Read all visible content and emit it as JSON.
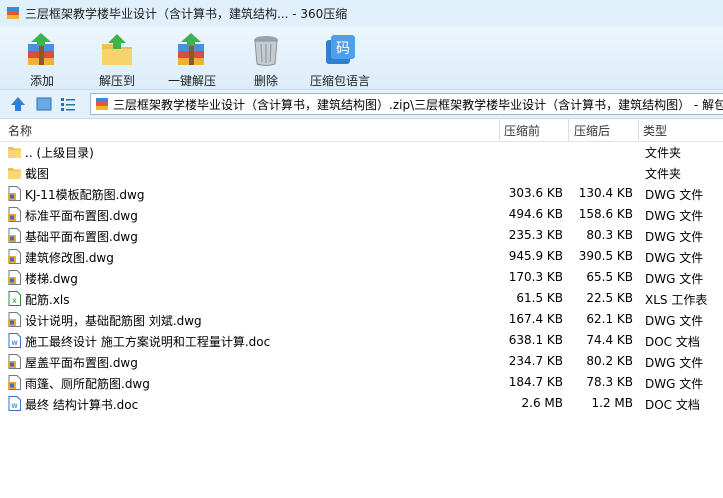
{
  "window": {
    "title": "三层框架教学楼毕业设计（含计算书，建筑结构... - 360压缩"
  },
  "toolbar": {
    "add_label": "添加",
    "extract_to_label": "解压到",
    "one_click_extract_label": "一键解压",
    "delete_label": "删除",
    "archive_language_label": "压缩包语言",
    "lang_icon_glyph": "码"
  },
  "address": {
    "path": "三层框架教学楼毕业设计（含计算书，建筑结构图）.zip\\三层框架教学楼毕业设计（含计算书，建筑结构图） - 解包"
  },
  "columns": {
    "name": "名称",
    "compressed_before": "压缩前",
    "compressed_after": "压缩后",
    "type": "类型"
  },
  "files": [
    {
      "name": ".. (上级目录)",
      "size": "",
      "packed": "",
      "type": "文件夹",
      "icon": "folder-icon"
    },
    {
      "name": "截图",
      "size": "",
      "packed": "",
      "type": "文件夹",
      "icon": "folder-icon"
    },
    {
      "name": "KJ-11模板配筋图.dwg",
      "size": "303.6 KB",
      "packed": "130.4 KB",
      "type": "DWG 文件",
      "icon": "dwg-file-icon"
    },
    {
      "name": "标准平面布置图.dwg",
      "size": "494.6 KB",
      "packed": "158.6 KB",
      "type": "DWG 文件",
      "icon": "dwg-file-icon"
    },
    {
      "name": "基础平面布置图.dwg",
      "size": "235.3 KB",
      "packed": "80.3 KB",
      "type": "DWG 文件",
      "icon": "dwg-file-icon"
    },
    {
      "name": "建筑修改图.dwg",
      "size": "945.9 KB",
      "packed": "390.5 KB",
      "type": "DWG 文件",
      "icon": "dwg-file-icon"
    },
    {
      "name": "楼梯.dwg",
      "size": "170.3 KB",
      "packed": "65.5 KB",
      "type": "DWG 文件",
      "icon": "dwg-file-icon"
    },
    {
      "name": "配筋.xls",
      "size": "61.5 KB",
      "packed": "22.5 KB",
      "type": "XLS 工作表",
      "icon": "xls-file-icon"
    },
    {
      "name": "设计说明，基础配筋图  刘斌.dwg",
      "size": "167.4 KB",
      "packed": "62.1 KB",
      "type": "DWG 文件",
      "icon": "dwg-file-icon"
    },
    {
      "name": "施工最终设计 施工方案说明和工程量计算.doc",
      "size": "638.1 KB",
      "packed": "74.4 KB",
      "type": "DOC 文档",
      "icon": "doc-file-icon"
    },
    {
      "name": "屋盖平面布置图.dwg",
      "size": "234.7 KB",
      "packed": "80.2 KB",
      "type": "DWG 文件",
      "icon": "dwg-file-icon"
    },
    {
      "name": "雨篷、厕所配筋图.dwg",
      "size": "184.7 KB",
      "packed": "78.3 KB",
      "type": "DWG 文件",
      "icon": "dwg-file-icon"
    },
    {
      "name": "最终 结构计算书.doc",
      "size": "2.6 MB",
      "packed": "1.2 MB",
      "type": "DOC 文档",
      "icon": "doc-file-icon"
    }
  ],
  "colors": {
    "title_bg": "#dff0fb",
    "toolbar_bg": "#e4f1fb",
    "folder": "#f5c95a",
    "dwg_badge": "#e8a83a",
    "xls": "#2e8b3e",
    "doc": "#3a6fc8"
  }
}
